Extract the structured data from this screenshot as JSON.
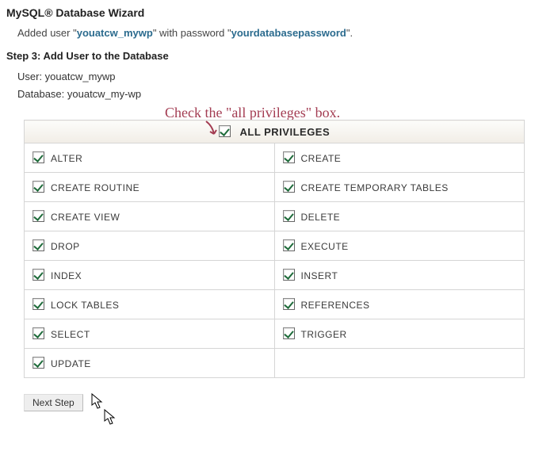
{
  "title": "MySQL® Database Wizard",
  "added": {
    "prefix": "Added user \"",
    "user": "youatcw_mywp",
    "mid": "\" with password \"",
    "password": "yourdatabasepassword",
    "suffix": "\"."
  },
  "step": "Step 3: Add User to the Database",
  "user_label": "User: ",
  "user_value": "youatcw_mywp",
  "db_label": "Database: ",
  "db_value": "youatcw_my-wp",
  "annotation": "Check the \"all privileges\" box.",
  "all_label": "ALL PRIVILEGES",
  "privileges": [
    [
      "ALTER",
      "CREATE"
    ],
    [
      "CREATE ROUTINE",
      "CREATE TEMPORARY TABLES"
    ],
    [
      "CREATE VIEW",
      "DELETE"
    ],
    [
      "DROP",
      "EXECUTE"
    ],
    [
      "INDEX",
      "INSERT"
    ],
    [
      "LOCK TABLES",
      "REFERENCES"
    ],
    [
      "SELECT",
      "TRIGGER"
    ],
    [
      "UPDATE",
      ""
    ]
  ],
  "next_label": "Next Step"
}
